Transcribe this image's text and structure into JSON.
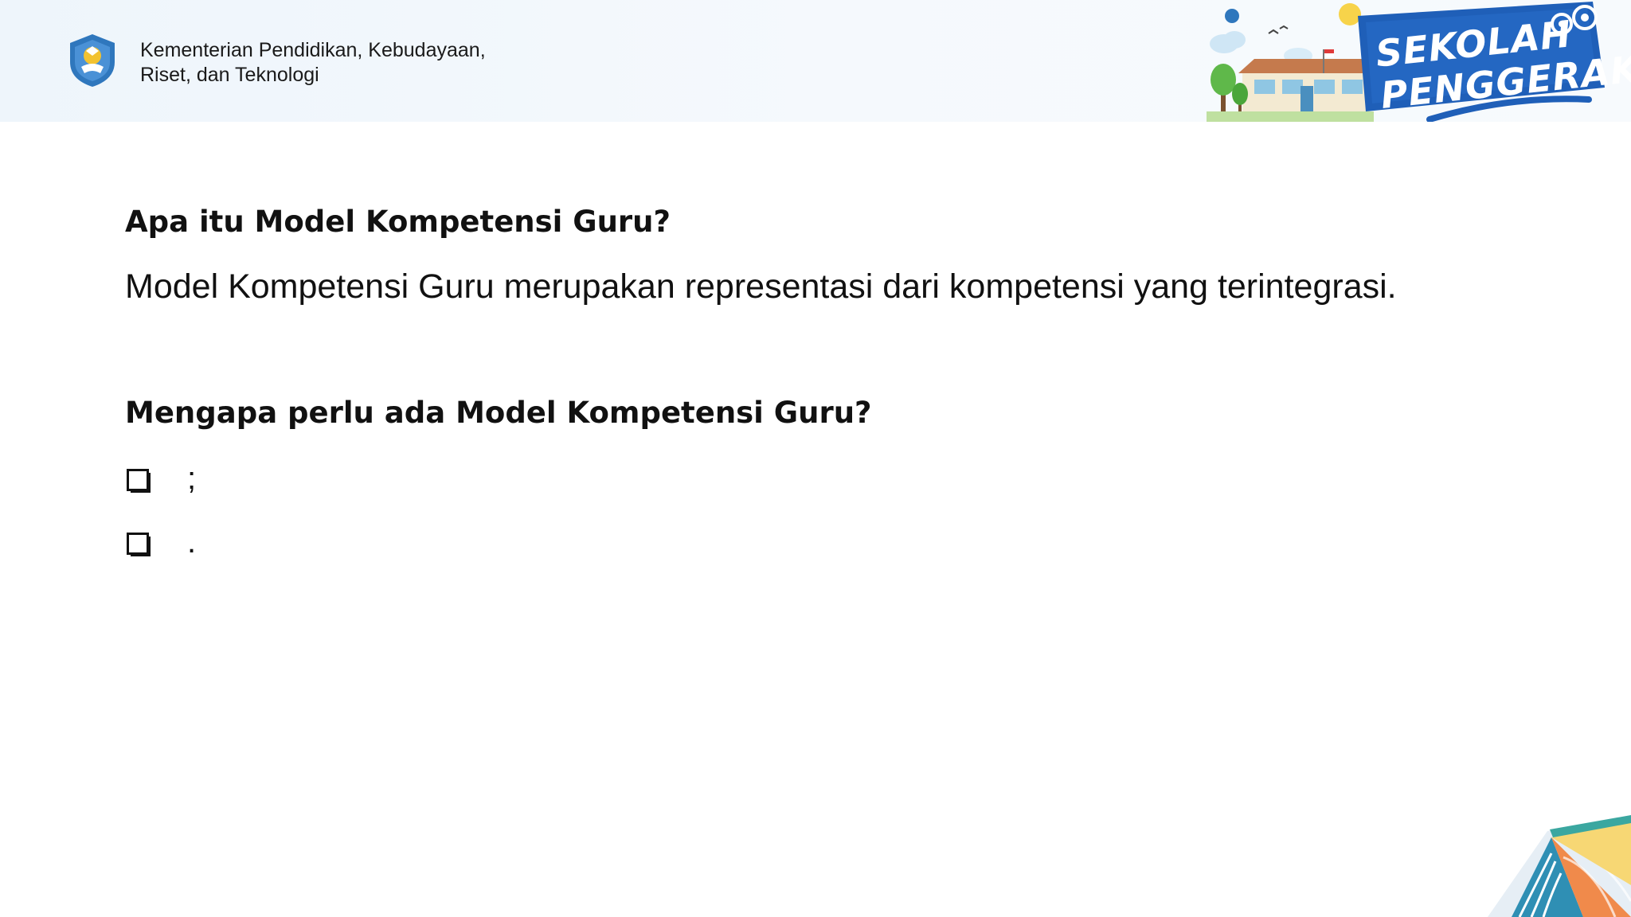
{
  "header": {
    "ministry_line1": "Kementerian Pendidikan, Kebudayaan,",
    "ministry_line2": "Riset, dan Teknologi",
    "logo_icon": "tut-wuri-handayani-logo-icon",
    "banner_line1": "SEKOLAH",
    "banner_line2": "PENGGERAK"
  },
  "content": {
    "question1": "Apa itu Model Kompetensi Guru?",
    "answer1": "Model Kompetensi Guru merupakan representasi dari kompetensi yang terintegrasi.",
    "question2": "Mengapa perlu ada Model Kompetensi Guru?",
    "bullets": [
      {
        "icon": "checkbox-icon",
        "text": ";"
      },
      {
        "icon": "checkbox-icon",
        "text": "."
      }
    ]
  },
  "colors": {
    "banner_blue": "#1f5fb8",
    "header_bg": "#eef5fb",
    "logo_blue": "#2f77bd"
  }
}
